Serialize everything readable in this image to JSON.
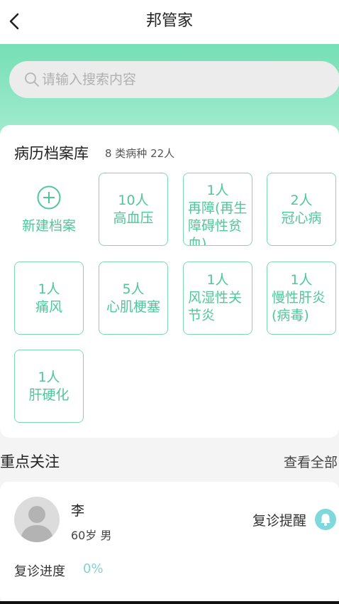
{
  "header": {
    "title": "邦管家"
  },
  "search": {
    "placeholder": "请输入搜索内容"
  },
  "records": {
    "title": "病历档案库",
    "summary": "8 类病种 22人",
    "new_label": "新建档案",
    "tiles": [
      {
        "count": "10人",
        "name": "高血压"
      },
      {
        "count": "1人",
        "name": "再障(再生障碍性贫血)"
      },
      {
        "count": "2人",
        "name": "冠心病"
      },
      {
        "count": "1人",
        "name": "痛风"
      },
      {
        "count": "5人",
        "name": "心肌梗塞"
      },
      {
        "count": "1人",
        "name": "风湿性关节炎"
      },
      {
        "count": "1人",
        "name": "慢性肝炎(病毒)"
      },
      {
        "count": "1人",
        "name": "肝硬化"
      }
    ]
  },
  "focus": {
    "title": "重点关注",
    "more": "查看全部"
  },
  "patient": {
    "name": "李",
    "info": "60岁 男",
    "reminder": "复诊提醒",
    "progress_label": "复诊进度",
    "progress_value": "0%"
  },
  "colors": {
    "accent": "#4fc79a",
    "band": "#75dfb5",
    "bell": "#7fd9dc"
  }
}
